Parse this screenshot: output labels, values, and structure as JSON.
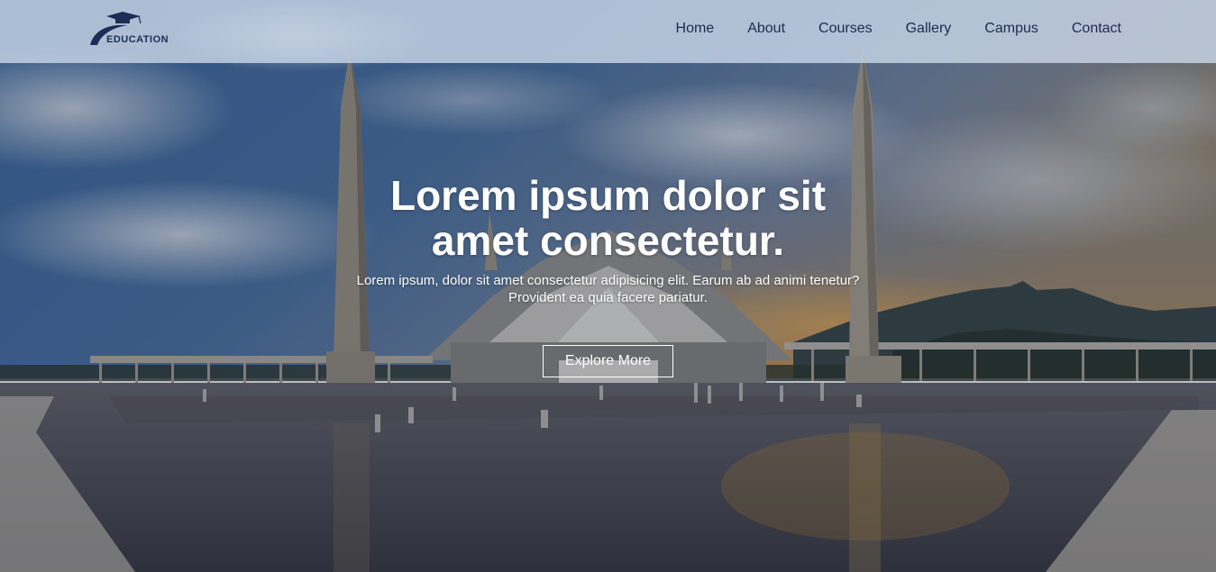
{
  "brand": {
    "logo_text": "EDUCATION",
    "logo_icon": "graduation-cap-icon"
  },
  "nav": {
    "items": [
      {
        "label": "Home"
      },
      {
        "label": "About"
      },
      {
        "label": "Courses"
      },
      {
        "label": "Gallery"
      },
      {
        "label": "Campus"
      },
      {
        "label": "Contact"
      }
    ]
  },
  "hero": {
    "title": "Lorem ipsum dolor sit amet consectetur.",
    "subtitle": "Lorem ipsum, dolor sit amet consectetur adipisicing elit. Earum ab ad animi tenetur? Provident ea quia facere pariatur.",
    "cta_label": "Explore More"
  },
  "colors": {
    "header_bg": "#c8d6e6",
    "nav_text": "#1f2a4d",
    "logo": "#1c2d55",
    "hero_text": "#ffffff"
  }
}
